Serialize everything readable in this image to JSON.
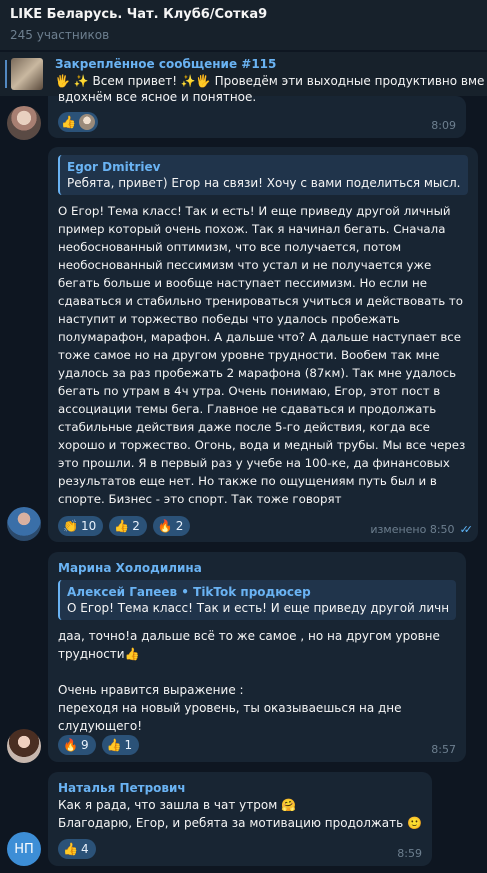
{
  "header": {
    "title": "LIKE Беларусь. Чат. Клуб6/Сотка9",
    "members": "245 участников"
  },
  "pinned": {
    "title": "Закреплённое сообщение #115",
    "text": "🖐 ✨ Всем привет! ✨🖐  Проведём эти выходные продуктивно вме"
  },
  "messages": [
    {
      "cut_text": "вдохнём все  ясное и понятное.",
      "reactions": [
        {
          "emoji": "👍",
          "count": ""
        }
      ],
      "time": "8:09"
    },
    {
      "reply_name": "Egor Dmitriev",
      "reply_text": "Ребята, привет) Егор на связи!  Хочу с вами поделиться мысл...",
      "text": "О Егор! Тема класс! Так и есть! И еще приведу другой личный пример который очень похож. Так я начинал бегать. Сначала необоснованный оптимизм, что все получается, потом необоснованный пессимизм что устал и не получается уже бегать больше и вообще наступает пессимизм. Но если не сдаваться и стабильно тренироваться учиться и действовать то наступит и торжество победы что удалось пробежать полумарафон, марафон. А дальше что? А дальше наступает все тоже самое но на другом уровне трудности. Вообем так мне удалось за раз пробежать 2 марафона (87км). Так мне удалось бегать по утрам в 4ч утра. Очень понимаю, Егор, этот пост в ассоциации темы бега. Главное не сдаваться и продолжать стабильные действия даже после 5-го действия, когда все хорошо и торжество. Огонь, вода и медный трубы. Мы все через это прошли. Я в первый раз у учебе на 100-ке, да финансовых результатов еще нет. Но также по ощущениям путь был и в спорте. Бизнес - это спорт. Так тоже говорят",
      "reactions": [
        {
          "emoji": "👏",
          "count": "10"
        },
        {
          "emoji": "👍",
          "count": "2"
        },
        {
          "emoji": "🔥",
          "count": "2"
        }
      ],
      "time": "изменено 8:50"
    },
    {
      "sender": "Марина Холодилина",
      "reply_name": "Алексей Гапеев • TikTok продюсер",
      "reply_text": "О Егор! Тема класс! Так и есть! И еще приведу другой личный ...",
      "text": "даа, точно!а дальше всё то же самое , но на другом уровне трудности👍\n\nОчень нравится выражение :\nпереходя на новый уровень, ты оказываешься на дне слудующего!",
      "reactions": [
        {
          "emoji": "🔥",
          "count": "9"
        },
        {
          "emoji": "👍",
          "count": "1"
        }
      ],
      "time": "8:57"
    },
    {
      "sender": "Наталья Петрович",
      "text": "Как я рада, что зашла в чат утром 🤗\nБлагодарю, Егор, и ребята за мотивацию продолжать 🙂",
      "reactions": [
        {
          "emoji": "👍",
          "count": "4"
        }
      ],
      "time": "8:59"
    }
  ],
  "avatar_initials": "НП",
  "colors": {
    "background": "#0e1621",
    "bubble": "#182533",
    "accent": "#6ab3f3",
    "reaction": "#2b5278"
  }
}
